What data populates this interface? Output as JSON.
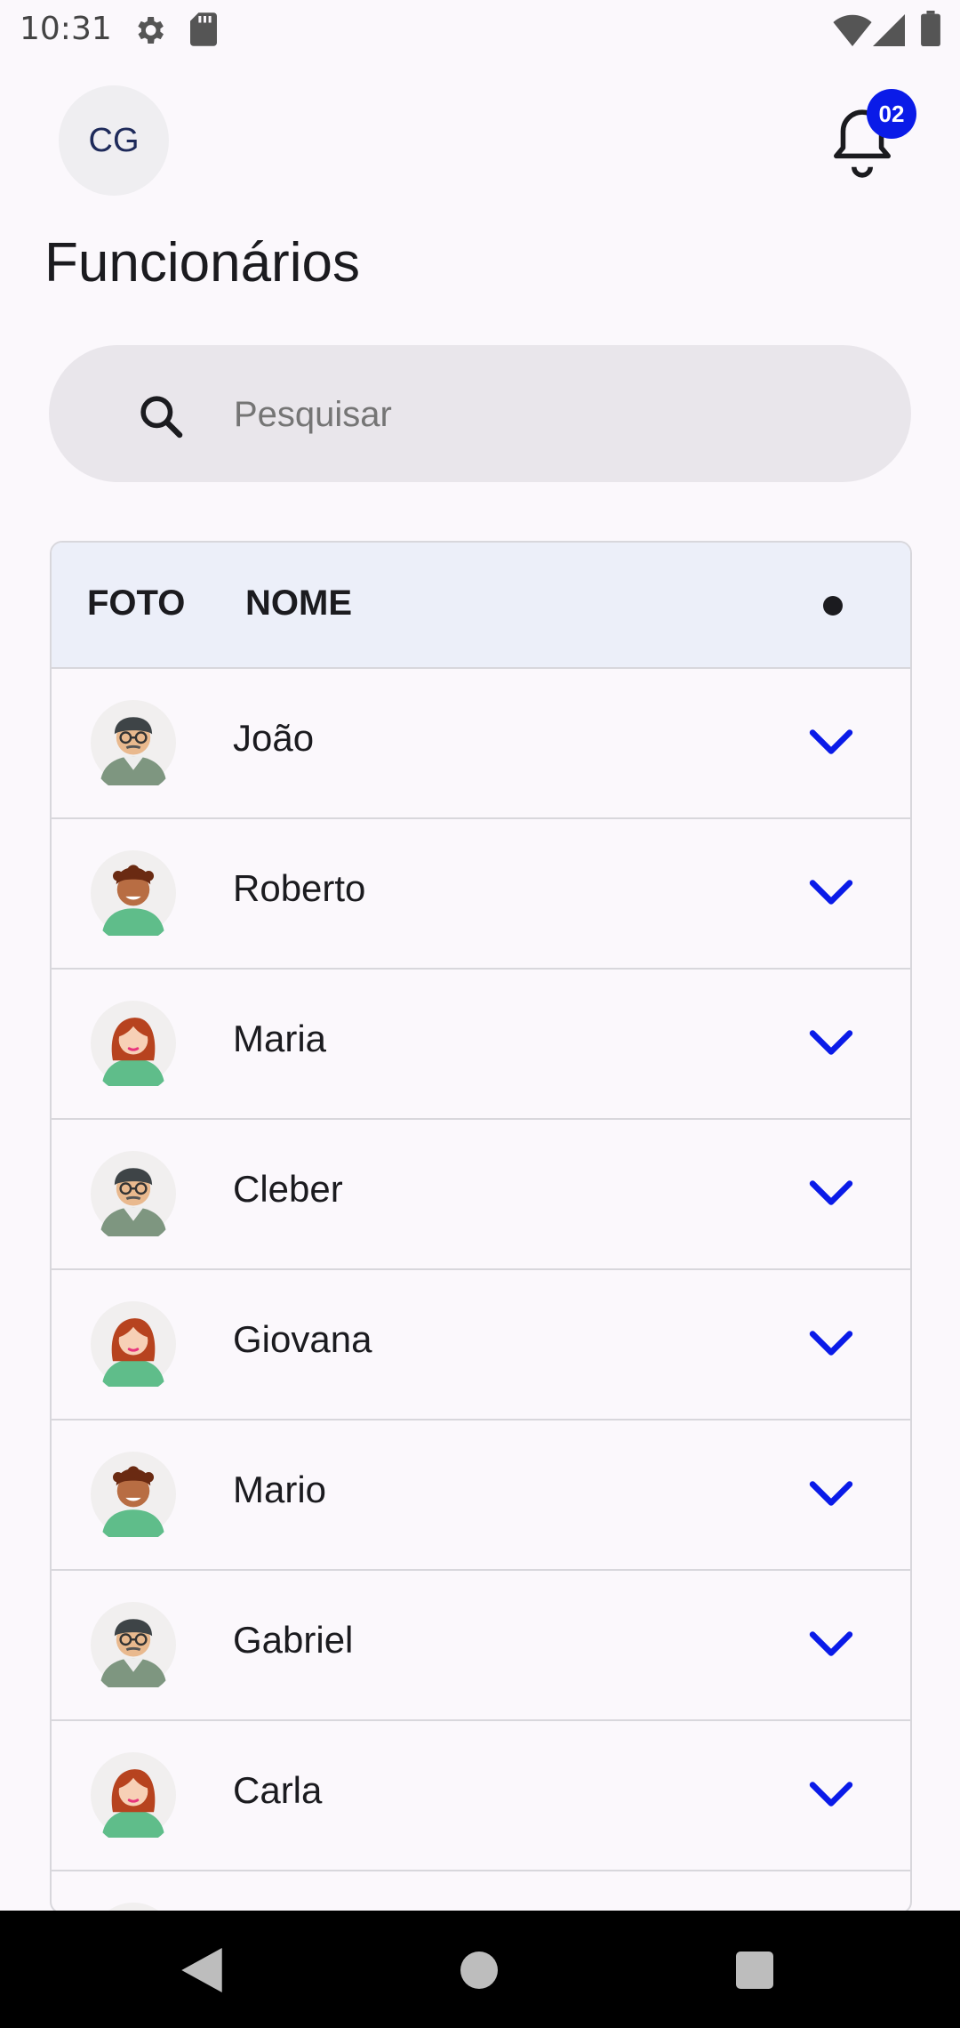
{
  "status_bar": {
    "time": "10:31"
  },
  "header": {
    "avatar_initials": "CG",
    "notification_count": "02"
  },
  "page": {
    "title": "Funcionários"
  },
  "search": {
    "placeholder": "Pesquisar",
    "value": ""
  },
  "table": {
    "headers": {
      "photo": "FOTO",
      "name": "NOME"
    },
    "rows": [
      {
        "name": "João",
        "avatar": "man-glasses"
      },
      {
        "name": "Roberto",
        "avatar": "man-curly"
      },
      {
        "name": "Maria",
        "avatar": "woman-red"
      },
      {
        "name": "Cleber",
        "avatar": "man-glasses"
      },
      {
        "name": "Giovana",
        "avatar": "woman-red"
      },
      {
        "name": "Mario",
        "avatar": "man-curly"
      },
      {
        "name": "Gabriel",
        "avatar": "man-glasses"
      },
      {
        "name": "Carla",
        "avatar": "woman-red"
      },
      {
        "name": "",
        "avatar": "woman-red"
      }
    ]
  },
  "colors": {
    "accent": "#0A1BE8",
    "header_bg": "#ECEFF9",
    "search_bg": "#E9E6EB"
  }
}
